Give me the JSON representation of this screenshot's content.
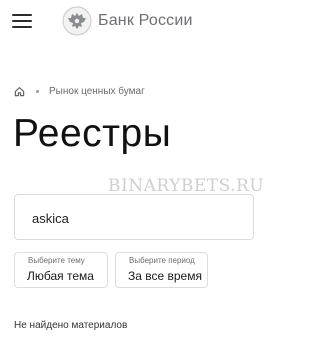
{
  "header": {
    "menu_icon": "hamburger-menu-icon",
    "logo_icon": "double-headed-eagle-emblem",
    "logo_text": "Банк России"
  },
  "breadcrumb": {
    "home_icon": "home-icon",
    "items": [
      "Рынок ценных бумаг"
    ]
  },
  "page": {
    "title": "Реестры"
  },
  "watermark": "BINARYBETS.RU",
  "search": {
    "value": "askica"
  },
  "filters": {
    "topic": {
      "label": "Выберите тему",
      "value": "Любая тема"
    },
    "period": {
      "label": "Выберите период",
      "value": "За все время"
    }
  },
  "results": {
    "empty_message": "Не найдено материалов"
  },
  "colors": {
    "text": "#1a1a1a",
    "muted": "#6d6f72",
    "border": "#d9dbe0",
    "background": "#ffffff"
  }
}
